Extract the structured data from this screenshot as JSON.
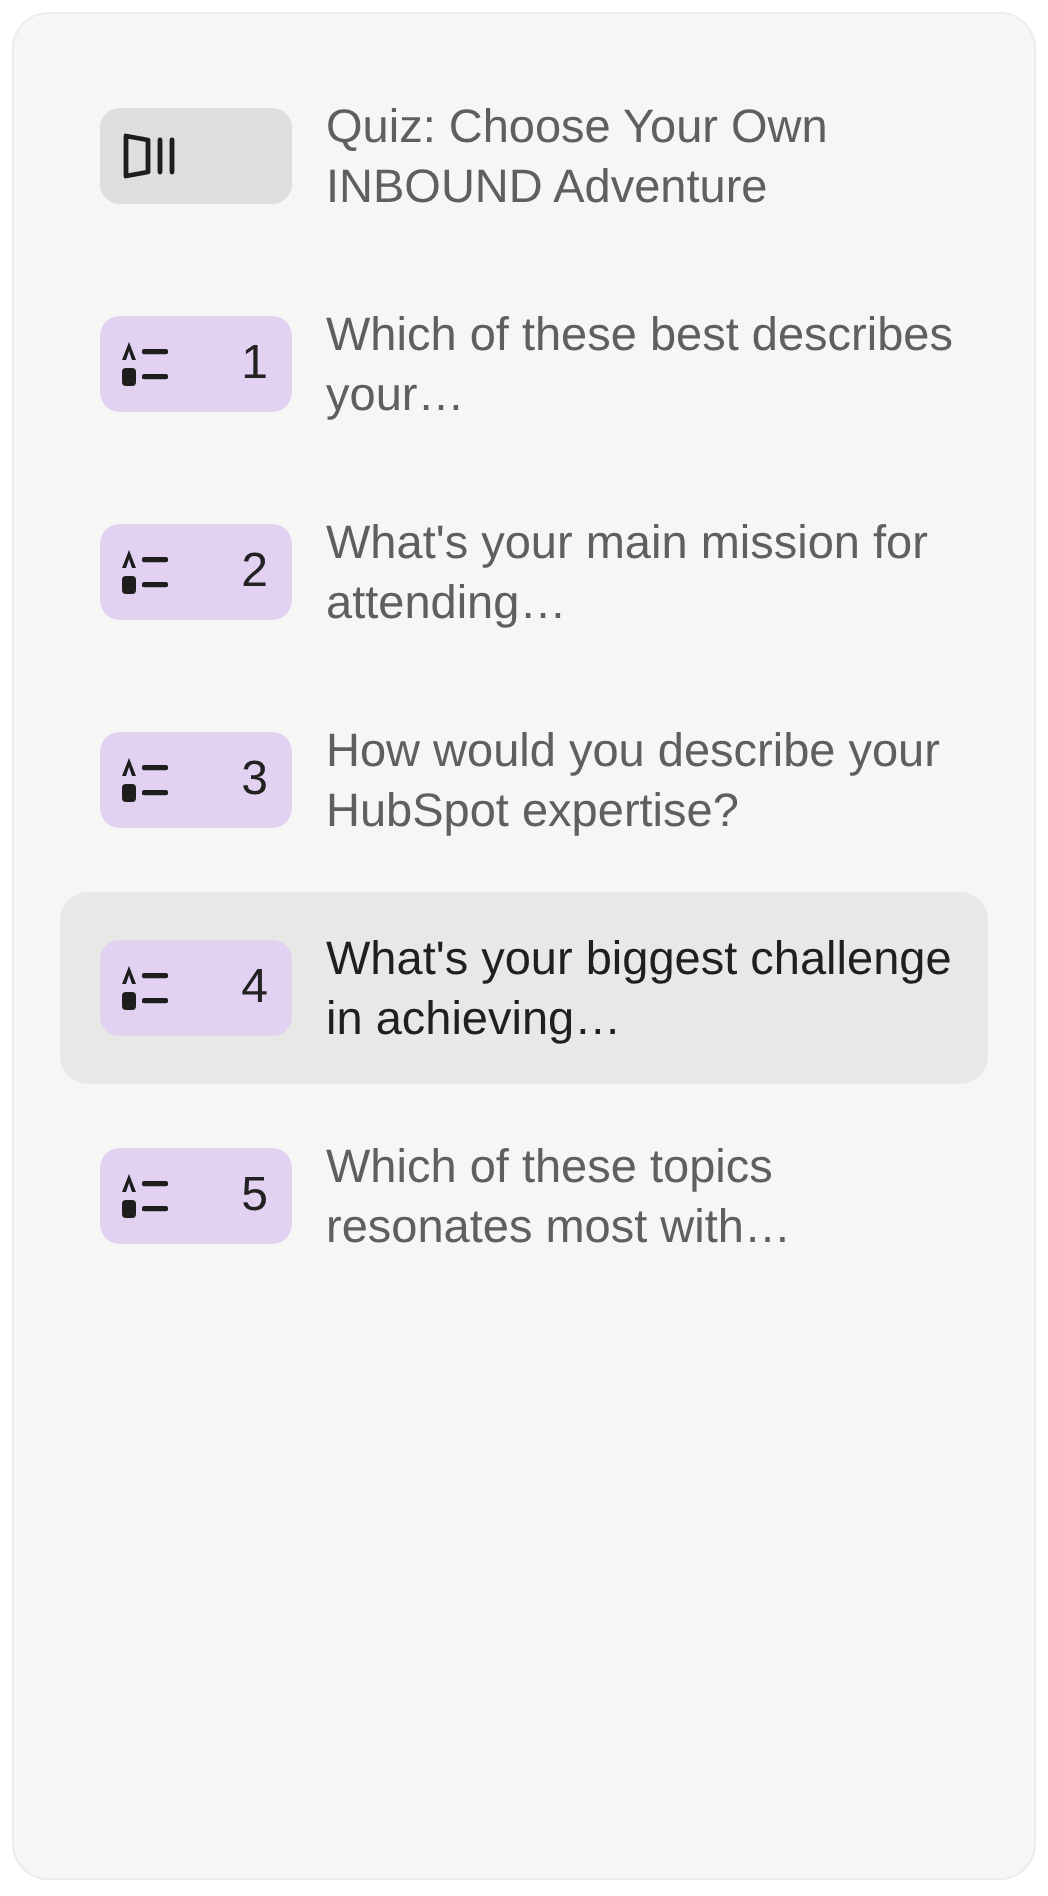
{
  "items": [
    {
      "kind": "cover",
      "title": "Quiz: Choose Your Own INBOUND Adventure",
      "selected": false
    },
    {
      "kind": "question",
      "number": "1",
      "title": "Which of these best describes your…",
      "selected": false
    },
    {
      "kind": "question",
      "number": "2",
      "title": "What's your main mission for attending…",
      "selected": false
    },
    {
      "kind": "question",
      "number": "3",
      "title": "How would you describe your HubSpot expertise?",
      "selected": false
    },
    {
      "kind": "question",
      "number": "4",
      "title": "What's your biggest challenge in achieving…",
      "selected": true
    },
    {
      "kind": "question",
      "number": "5",
      "title": "Which of these topics resonates most with…",
      "selected": false
    }
  ]
}
